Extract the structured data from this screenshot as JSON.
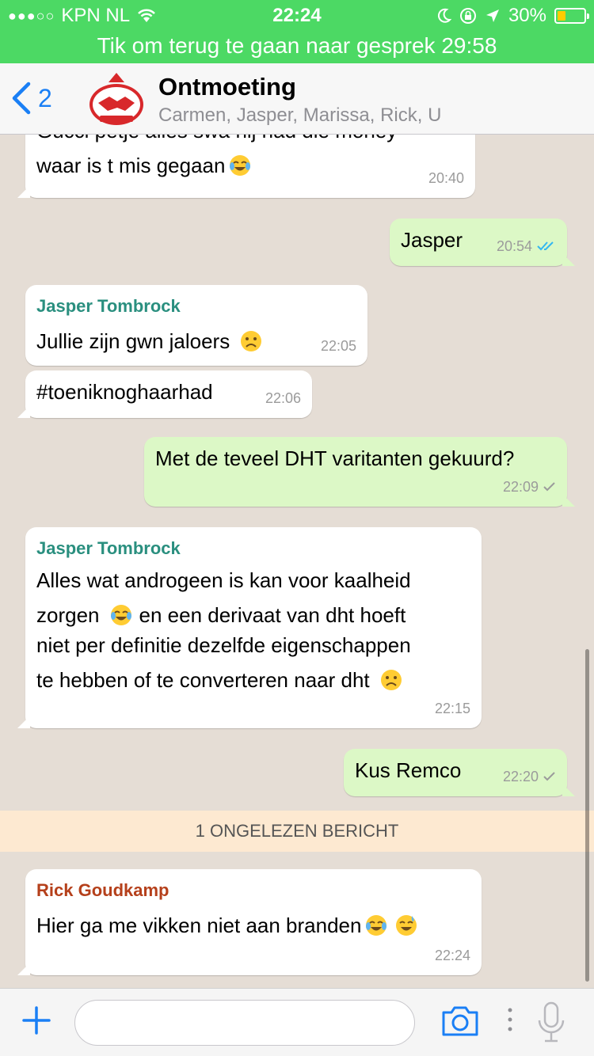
{
  "status_bar": {
    "signal_dots": "●●●○○",
    "carrier": "KPN NL",
    "time": "22:24",
    "battery_pct": "30%",
    "battery_level": 0.3,
    "call_banner": "Tik om terug te gaan naar gesprek 29:58",
    "bg_color": "#4cd964"
  },
  "header": {
    "back_count": "2",
    "title": "Ontmoeting",
    "subtitle": "Carmen, Jasper, Marissa, Rick, U",
    "avatar_icon": "de-ontmoeting-logo-icon"
  },
  "chat": {
    "messages": [
      {
        "type": "in",
        "lines": [
          "Gucci petje alles swa hij had die money",
          "waar is t mis gegaan"
        ],
        "emoji_after": "tears-of-joy",
        "time": "20:40"
      },
      {
        "type": "out",
        "text": "Jasper",
        "time": "20:54",
        "ticks": "read"
      },
      {
        "type": "in",
        "sender": "Jasper Tombrock",
        "sender_color": "#2a8f7f",
        "text": "Jullie zijn gwn jaloers",
        "emoji_after": "frowning",
        "time": "22:05"
      },
      {
        "type": "in",
        "text": "#toeniknoghaarhad",
        "time": "22:06"
      },
      {
        "type": "out",
        "text": "Met de teveel DHT varitanten gekuurd?",
        "time": "22:09",
        "ticks": "sent"
      },
      {
        "type": "in",
        "sender": "Jasper Tombrock",
        "sender_color": "#2a8f7f",
        "lines": [
          "Alles wat androgeen is kan voor kaalheid",
          "zorgen",
          "en een derivaat van dht hoeft",
          "niet per definitie dezelfde eigenschappen",
          "te hebben of te converteren naar dht"
        ],
        "time": "22:15"
      },
      {
        "type": "out",
        "text": "Kus Remco",
        "time": "22:20",
        "ticks": "sent"
      },
      {
        "type": "in",
        "sender": "Rick Goudkamp",
        "sender_color": "#b5401b",
        "text": "Hier ga me vikken niet aan branden",
        "time": "22:24"
      }
    ],
    "unread_banner": "1 ONGELEZEN BERICHT",
    "read_tick_color": "#34b7f1",
    "sent_tick_color": "#9b9b9b"
  },
  "input_bar": {
    "placeholder": "",
    "accent": "#1a7ff5"
  }
}
